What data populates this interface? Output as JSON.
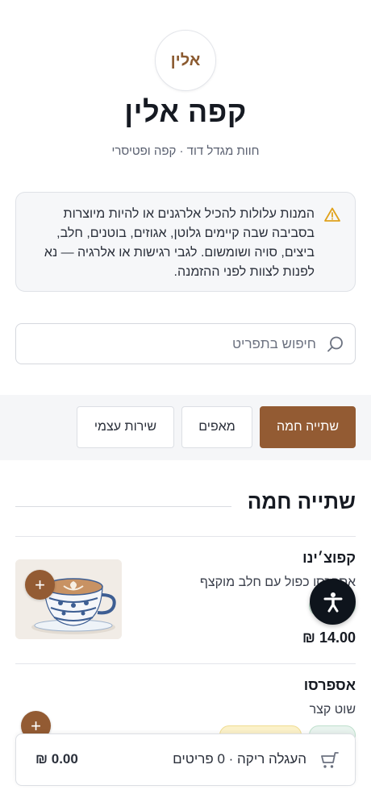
{
  "header": {
    "logo_text": "אלין",
    "title": "קפה אלין",
    "subtitle": "חוות מגדל דוד · קפה ופטיסרי"
  },
  "allergy_notice": {
    "icon": "warning-triangle-icon",
    "text": "המנות עלולות להכיל אלרגנים או להיות מיוצרות בסביבה שבה קיימים גלוטן, אגוזים, בוטנים, חלב, ביצים, סויה ושומשום. לגבי רגישות או אלרגיה — נא לפנות לצוות לפני ההזמנה."
  },
  "search": {
    "placeholder": "חיפוש בתפריט",
    "value": ""
  },
  "tabs": [
    {
      "label": "שתייה חמה",
      "active": true
    },
    {
      "label": "מאפים",
      "active": false
    },
    {
      "label": "שירות עצמי",
      "active": false
    }
  ],
  "section": {
    "title": "שתייה חמה"
  },
  "items": [
    {
      "name": "קפוצ׳ינו",
      "description": "אספרסו כפול עם חלב מוקצף",
      "price": "14.00 ₪",
      "add_label": "+"
    },
    {
      "name": "אספרסו",
      "description": "שוט קצר",
      "add_label": "+"
    }
  ],
  "cart": {
    "status": "העגלה ריקה · 0 פריטים",
    "total": "₪ 0.00"
  },
  "colors": {
    "accent": "#935b33",
    "logo_text": "#8b5a30",
    "warning": "#e0a21c",
    "a11y_button": "#0e141c"
  }
}
